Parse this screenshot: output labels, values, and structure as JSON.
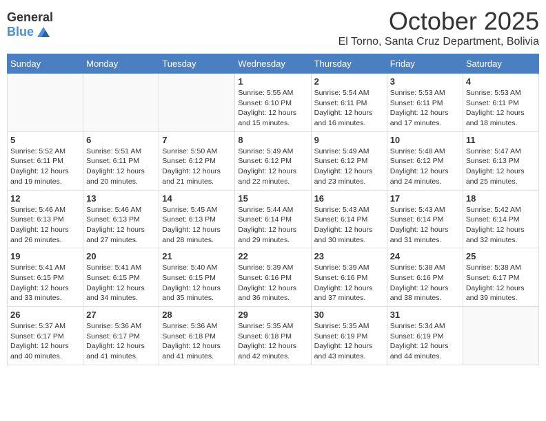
{
  "header": {
    "logo_general": "General",
    "logo_blue": "Blue",
    "month": "October 2025",
    "location": "El Torno, Santa Cruz Department, Bolivia"
  },
  "calendar": {
    "days_of_week": [
      "Sunday",
      "Monday",
      "Tuesday",
      "Wednesday",
      "Thursday",
      "Friday",
      "Saturday"
    ],
    "weeks": [
      [
        {
          "day": "",
          "info": ""
        },
        {
          "day": "",
          "info": ""
        },
        {
          "day": "",
          "info": ""
        },
        {
          "day": "1",
          "info": "Sunrise: 5:55 AM\nSunset: 6:10 PM\nDaylight: 12 hours\nand 15 minutes."
        },
        {
          "day": "2",
          "info": "Sunrise: 5:54 AM\nSunset: 6:11 PM\nDaylight: 12 hours\nand 16 minutes."
        },
        {
          "day": "3",
          "info": "Sunrise: 5:53 AM\nSunset: 6:11 PM\nDaylight: 12 hours\nand 17 minutes."
        },
        {
          "day": "4",
          "info": "Sunrise: 5:53 AM\nSunset: 6:11 PM\nDaylight: 12 hours\nand 18 minutes."
        }
      ],
      [
        {
          "day": "5",
          "info": "Sunrise: 5:52 AM\nSunset: 6:11 PM\nDaylight: 12 hours\nand 19 minutes."
        },
        {
          "day": "6",
          "info": "Sunrise: 5:51 AM\nSunset: 6:11 PM\nDaylight: 12 hours\nand 20 minutes."
        },
        {
          "day": "7",
          "info": "Sunrise: 5:50 AM\nSunset: 6:12 PM\nDaylight: 12 hours\nand 21 minutes."
        },
        {
          "day": "8",
          "info": "Sunrise: 5:49 AM\nSunset: 6:12 PM\nDaylight: 12 hours\nand 22 minutes."
        },
        {
          "day": "9",
          "info": "Sunrise: 5:49 AM\nSunset: 6:12 PM\nDaylight: 12 hours\nand 23 minutes."
        },
        {
          "day": "10",
          "info": "Sunrise: 5:48 AM\nSunset: 6:12 PM\nDaylight: 12 hours\nand 24 minutes."
        },
        {
          "day": "11",
          "info": "Sunrise: 5:47 AM\nSunset: 6:13 PM\nDaylight: 12 hours\nand 25 minutes."
        }
      ],
      [
        {
          "day": "12",
          "info": "Sunrise: 5:46 AM\nSunset: 6:13 PM\nDaylight: 12 hours\nand 26 minutes."
        },
        {
          "day": "13",
          "info": "Sunrise: 5:46 AM\nSunset: 6:13 PM\nDaylight: 12 hours\nand 27 minutes."
        },
        {
          "day": "14",
          "info": "Sunrise: 5:45 AM\nSunset: 6:13 PM\nDaylight: 12 hours\nand 28 minutes."
        },
        {
          "day": "15",
          "info": "Sunrise: 5:44 AM\nSunset: 6:14 PM\nDaylight: 12 hours\nand 29 minutes."
        },
        {
          "day": "16",
          "info": "Sunrise: 5:43 AM\nSunset: 6:14 PM\nDaylight: 12 hours\nand 30 minutes."
        },
        {
          "day": "17",
          "info": "Sunrise: 5:43 AM\nSunset: 6:14 PM\nDaylight: 12 hours\nand 31 minutes."
        },
        {
          "day": "18",
          "info": "Sunrise: 5:42 AM\nSunset: 6:14 PM\nDaylight: 12 hours\nand 32 minutes."
        }
      ],
      [
        {
          "day": "19",
          "info": "Sunrise: 5:41 AM\nSunset: 6:15 PM\nDaylight: 12 hours\nand 33 minutes."
        },
        {
          "day": "20",
          "info": "Sunrise: 5:41 AM\nSunset: 6:15 PM\nDaylight: 12 hours\nand 34 minutes."
        },
        {
          "day": "21",
          "info": "Sunrise: 5:40 AM\nSunset: 6:15 PM\nDaylight: 12 hours\nand 35 minutes."
        },
        {
          "day": "22",
          "info": "Sunrise: 5:39 AM\nSunset: 6:16 PM\nDaylight: 12 hours\nand 36 minutes."
        },
        {
          "day": "23",
          "info": "Sunrise: 5:39 AM\nSunset: 6:16 PM\nDaylight: 12 hours\nand 37 minutes."
        },
        {
          "day": "24",
          "info": "Sunrise: 5:38 AM\nSunset: 6:16 PM\nDaylight: 12 hours\nand 38 minutes."
        },
        {
          "day": "25",
          "info": "Sunrise: 5:38 AM\nSunset: 6:17 PM\nDaylight: 12 hours\nand 39 minutes."
        }
      ],
      [
        {
          "day": "26",
          "info": "Sunrise: 5:37 AM\nSunset: 6:17 PM\nDaylight: 12 hours\nand 40 minutes."
        },
        {
          "day": "27",
          "info": "Sunrise: 5:36 AM\nSunset: 6:17 PM\nDaylight: 12 hours\nand 41 minutes."
        },
        {
          "day": "28",
          "info": "Sunrise: 5:36 AM\nSunset: 6:18 PM\nDaylight: 12 hours\nand 41 minutes."
        },
        {
          "day": "29",
          "info": "Sunrise: 5:35 AM\nSunset: 6:18 PM\nDaylight: 12 hours\nand 42 minutes."
        },
        {
          "day": "30",
          "info": "Sunrise: 5:35 AM\nSunset: 6:19 PM\nDaylight: 12 hours\nand 43 minutes."
        },
        {
          "day": "31",
          "info": "Sunrise: 5:34 AM\nSunset: 6:19 PM\nDaylight: 12 hours\nand 44 minutes."
        },
        {
          "day": "",
          "info": ""
        }
      ]
    ]
  }
}
